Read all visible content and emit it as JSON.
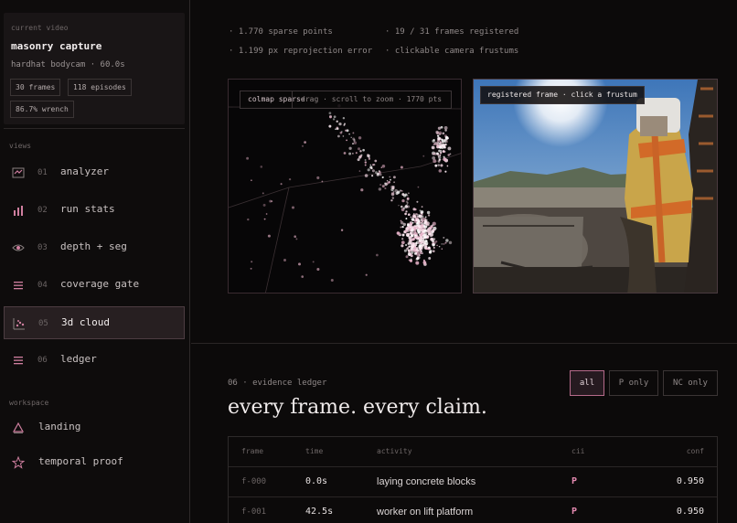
{
  "sidebar": {
    "current_video": {
      "caption": "current video",
      "title": "masonry capture",
      "subtitle": "hardhat bodycam · 60.0s",
      "chips": [
        "30 frames",
        "118 episodes",
        "86.7% wrench"
      ]
    },
    "views_label": "views",
    "views": [
      {
        "num": "01",
        "label": "analyzer",
        "icon": "analyzer-icon"
      },
      {
        "num": "02",
        "label": "run stats",
        "icon": "bar-chart-icon"
      },
      {
        "num": "03",
        "label": "depth + seg",
        "icon": "eye-icon"
      },
      {
        "num": "04",
        "label": "coverage gate",
        "icon": "list-icon"
      },
      {
        "num": "05",
        "label": "3d cloud",
        "icon": "cloud-chart-icon",
        "active": true
      },
      {
        "num": "06",
        "label": "ledger",
        "icon": "ledger-icon"
      }
    ],
    "workspace_label": "workspace",
    "workspace": [
      {
        "label": "landing",
        "icon": "landing-icon"
      },
      {
        "label": "temporal proof",
        "icon": "star-icon"
      }
    ]
  },
  "stats": {
    "sparse": "· 1.770 sparse points",
    "frames": "· 19 / 31 frames registered",
    "reproj": "· 1.199 px reprojection error",
    "frustums": "· clickable camera frustums"
  },
  "cloud": {
    "label": "colmap sparse",
    "hint": "drag · scroll to zoom · 1770 pts"
  },
  "frame_panel": {
    "tag": "registered frame · click a frustum"
  },
  "ledger": {
    "caption": "06 · evidence ledger",
    "title": "every frame. every claim.",
    "filters": [
      "all",
      "P only",
      "NC only"
    ],
    "columns": [
      "frame",
      "time",
      "activity",
      "cii",
      "conf"
    ],
    "rows": [
      {
        "frame": "f-000",
        "time": "0.0s",
        "activity": "laying concrete blocks",
        "cii": "P",
        "conf": "0.950"
      },
      {
        "frame": "f-001",
        "time": "42.5s",
        "activity": "worker on lift platform",
        "cii": "P",
        "conf": "0.950"
      }
    ]
  },
  "colors": {
    "accent": "#e48ab0",
    "background": "#0c0a0a",
    "active_bg": "#271f21"
  }
}
